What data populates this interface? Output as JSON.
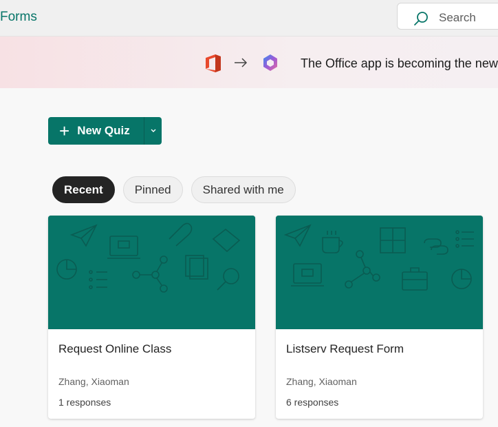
{
  "header": {
    "app_title": "Forms",
    "search_placeholder": "Search"
  },
  "banner": {
    "message": "The Office app is becoming the new"
  },
  "new_quiz": {
    "label": "New Quiz"
  },
  "tabs": [
    {
      "label": "Recent",
      "active": true
    },
    {
      "label": "Pinned",
      "active": false
    },
    {
      "label": "Shared with me",
      "active": false
    }
  ],
  "cards": [
    {
      "title": "Request Online Class",
      "owner": "Zhang, Xiaoman",
      "responses": "1 responses"
    },
    {
      "title": "Listserv Request Form",
      "owner": "Zhang, Xiaoman",
      "responses": "6 responses"
    }
  ],
  "colors": {
    "brand": "#077568",
    "active_tab": "#242424",
    "banner": "#f7e1e4"
  }
}
